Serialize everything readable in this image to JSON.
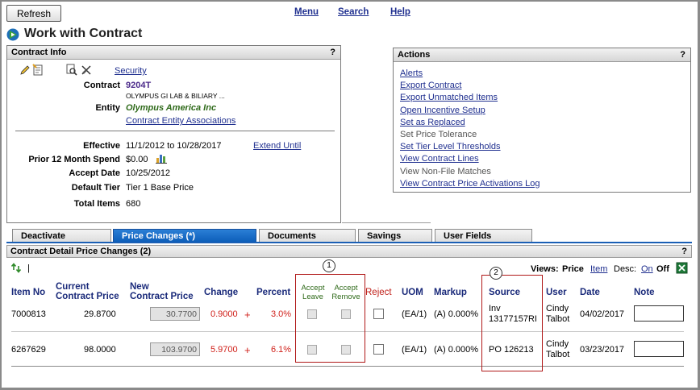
{
  "toolbar": {
    "refresh_label": "Refresh"
  },
  "nav": {
    "menu": "Menu",
    "search": "Search",
    "help": "Help"
  },
  "page": {
    "title": "Work with Contract"
  },
  "contract_info": {
    "header": "Contract Info",
    "help": "?",
    "security_link": "Security",
    "contract_label": "Contract",
    "contract_id": "9204T",
    "contract_name": "OLYMPUS GI LAB & BILIARY ...",
    "entity_label": "Entity",
    "entity_value": "Olympus America Inc",
    "entity_assoc_link": "Contract Entity Associations",
    "effective_label": "Effective",
    "effective_value": "11/1/2012 to 10/28/2017",
    "extend_link": "Extend Until",
    "spend_label": "Prior 12 Month Spend",
    "spend_value": "$0.00",
    "accept_label": "Accept Date",
    "accept_value": "10/25/2012",
    "tier_label": "Default Tier",
    "tier_value": "Tier 1 Base Price",
    "total_label": "Total Items",
    "total_value": "680"
  },
  "actions": {
    "header": "Actions",
    "help": "?",
    "items": [
      {
        "label": "Alerts",
        "enabled": true
      },
      {
        "label": "Export Contract",
        "enabled": true
      },
      {
        "label": "Export Unmatched Items",
        "enabled": true
      },
      {
        "label": "Open Incentive Setup",
        "enabled": true
      },
      {
        "label": "Set as Replaced",
        "enabled": true
      },
      {
        "label": "Set Price Tolerance",
        "enabled": false
      },
      {
        "label": "Set Tier Level Thresholds",
        "enabled": true
      },
      {
        "label": "View Contract Lines",
        "enabled": true
      },
      {
        "label": "View Non-File Matches",
        "enabled": false
      },
      {
        "label": "View Contract Price Activations Log",
        "enabled": true
      }
    ]
  },
  "tabs": [
    {
      "label": "Deactivate",
      "active": false
    },
    {
      "label": "Price Changes (*)",
      "active": true
    },
    {
      "label": "Documents",
      "active": false
    },
    {
      "label": "Savings",
      "active": false
    },
    {
      "label": "User Fields",
      "active": false
    }
  ],
  "detail": {
    "header": "Contract Detail Price Changes (2)",
    "help": "?",
    "separator": "|",
    "views_label": "Views:",
    "views_price": "Price",
    "views_item": "Item",
    "desc_label": "Desc:",
    "desc_on": "On",
    "desc_off": "Off",
    "columns": {
      "item_no": "Item No",
      "current_price_1": "Current",
      "current_price_2": "Contract Price",
      "new_price_1": "New",
      "new_price_2": "Contract Price",
      "change": "Change",
      "percent": "Percent",
      "accept_leave_1": "Accept",
      "accept_leave_2": "Leave",
      "accept_remove_1": "Accept",
      "accept_remove_2": "Remove",
      "reject": "Reject",
      "uom": "UOM",
      "markup": "Markup",
      "source": "Source",
      "user": "User",
      "date": "Date",
      "note": "Note"
    },
    "rows": [
      {
        "item_no": "7000813",
        "current_price": "29.8700",
        "new_price": "30.7700",
        "change": "0.9000",
        "change_sign": "+",
        "percent": "3.0%",
        "uom": "(EA/1)",
        "markup": "(A) 0.000%",
        "source_1": "Inv",
        "source_2": "13177157RI",
        "user_1": "Cindy",
        "user_2": "Talbot",
        "date": "04/02/2017"
      },
      {
        "item_no": "6267629",
        "current_price": "98.0000",
        "new_price": "103.9700",
        "change": "5.9700",
        "change_sign": "+",
        "percent": "6.1%",
        "uom": "(EA/1)",
        "markup": "(A) 0.000%",
        "source_1": "PO 126213",
        "source_2": "",
        "user_1": "Cindy",
        "user_2": "Talbot",
        "date": "03/23/2017"
      }
    ]
  },
  "annotations": {
    "badge_1": "1",
    "badge_2": "2"
  },
  "colors": {
    "accent_blue": "#0b5cb8",
    "link": "#1f2f8f",
    "change_red": "#d0201a",
    "callout_red": "#b01818"
  }
}
